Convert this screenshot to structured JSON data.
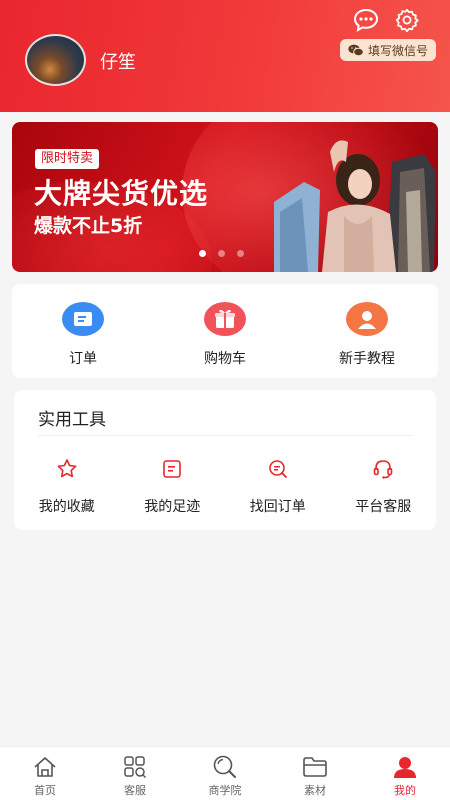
{
  "header": {
    "username": "仔笙",
    "wechat_pill": "填写微信号"
  },
  "banner": {
    "tag": "限时特卖",
    "title": "大牌尖货优选",
    "subtitle": "爆款不止5折",
    "page_count": 3,
    "active_page": 1
  },
  "quick_actions": [
    {
      "label": "订单",
      "icon": "order-icon",
      "color": "#3b8cf2"
    },
    {
      "label": "购物车",
      "icon": "gift-cart-icon",
      "color": "#f2525a"
    },
    {
      "label": "新手教程",
      "icon": "tutorial-user-icon",
      "color": "#f47644"
    }
  ],
  "tools": {
    "title": "实用工具",
    "items": [
      {
        "label": "我的收藏",
        "icon": "star-icon"
      },
      {
        "label": "我的足迹",
        "icon": "footprint-icon"
      },
      {
        "label": "找回订单",
        "icon": "search-order-icon"
      },
      {
        "label": "平台客服",
        "icon": "headset-icon"
      }
    ],
    "accent": "#e8262e"
  },
  "tabbar": {
    "items": [
      {
        "label": "首页",
        "icon": "home-icon"
      },
      {
        "label": "客服",
        "icon": "grid-icon"
      },
      {
        "label": "商学院",
        "icon": "search-icon"
      },
      {
        "label": "素材",
        "icon": "folder-icon"
      },
      {
        "label": "我的",
        "icon": "user-icon",
        "active": true
      }
    ]
  },
  "colors": {
    "brand_red": "#e8262e",
    "background": "#f5f5f5"
  }
}
